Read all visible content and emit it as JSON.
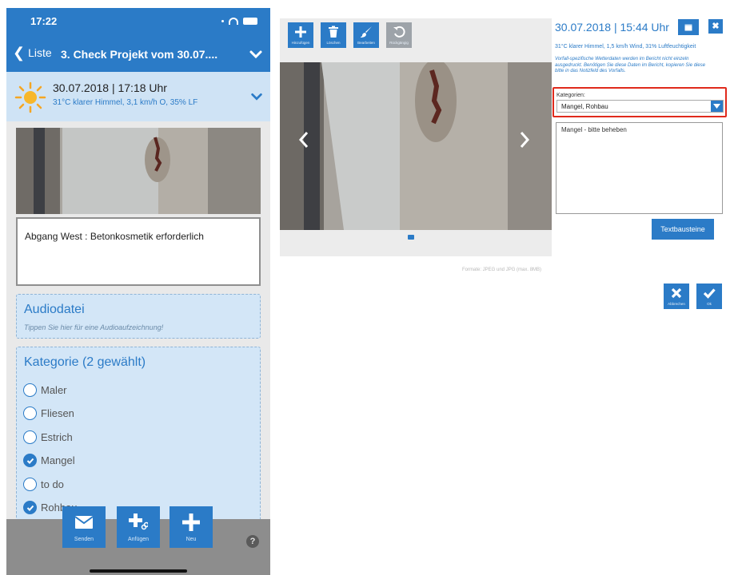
{
  "phone": {
    "status_time": "17:22",
    "nav": {
      "back_label": "Liste",
      "title": "3. Check Projekt vom 30.07...."
    },
    "weather": {
      "datetime": "30.07.2018 | 17:18 Uhr",
      "info": "31°C klarer Himmel, 3,1 km/h O, 35% LF"
    },
    "description": "Abgang West : Betonkosmetik erforderlich",
    "audio": {
      "title": "Audiodatei",
      "hint": "Tippen Sie hier für eine Audioaufzeichnung!"
    },
    "category": {
      "title": "Kategorie (2 gewählt)",
      "options": [
        {
          "label": "Maler",
          "checked": false
        },
        {
          "label": "Fliesen",
          "checked": false
        },
        {
          "label": "Estrich",
          "checked": false
        },
        {
          "label": "Mangel",
          "checked": true
        },
        {
          "label": "to do",
          "checked": false
        },
        {
          "label": "Rohbau",
          "checked": true
        }
      ]
    },
    "actions": {
      "send": "Senden",
      "attach": "Anfügen",
      "new": "Neu"
    },
    "help": "?"
  },
  "editor": {
    "toolbar": {
      "add": "Hinzufügen",
      "delete": "Löschen",
      "edit": "Bearbeiten",
      "undo": "Rückgängig"
    },
    "formats": "Formate: JPEG und JPG (max. 8MB)",
    "datetime": "30.07.2018 | 15:44 Uhr",
    "weather": "31°C klarer Himmel, 1,5 km/h Wind, 31% Luftfeuchtigkeit",
    "weather_note": "Vorfall-spezifische Wetterdaten werden im Bericht nicht einzeln ausgedruckt. Benötigen Sie diese Daten im Bericht, kopieren Sie diese bitte in das Notizfeld des Vorfalls.",
    "categories_label": "Kategorien:",
    "categories_value": "Mangel, Rohbau",
    "note_text": "Mangel - bitte beheben",
    "textbausteine": "Textbausteine",
    "cancel": "Abbrechen",
    "ok": "Ok"
  },
  "colors": {
    "accent": "#2b7bc7",
    "highlight": "#e02a1c"
  }
}
